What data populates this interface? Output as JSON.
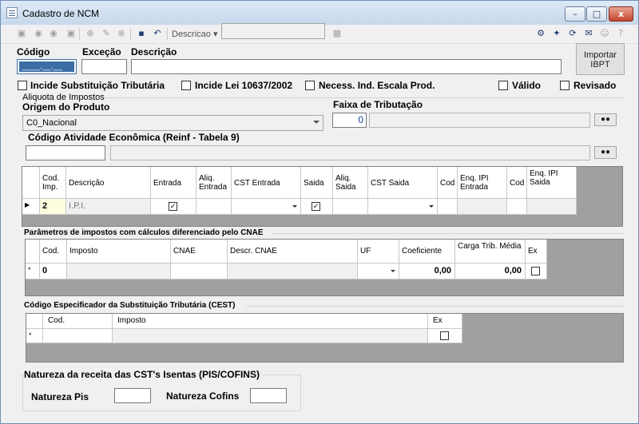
{
  "window": {
    "title": "Cadastro de NCM",
    "minimize_glyph": "–",
    "maximize_glyph": "□",
    "close_glyph": "x"
  },
  "toolbar": {
    "search_field_label": "Descricao",
    "search_value": ""
  },
  "form": {
    "codigo_label": "Código",
    "excecao_label": "Exceção",
    "descricao_label": "Descrição",
    "codigo_value": "____.__.__",
    "excecao_value": "",
    "descricao_value": "",
    "import_button": "Importar IBPT",
    "checkboxes": [
      {
        "label": "Incide Substituição Tributária",
        "checked": false
      },
      {
        "label": "Incide Lei 10637/2002",
        "checked": false
      },
      {
        "label": "Necess. Ind. Escala Prod.",
        "checked": false
      },
      {
        "label": "Válido",
        "checked": false
      },
      {
        "label": "Revisado",
        "checked": false
      }
    ]
  },
  "aliquota": {
    "group_title": "Aliquota de Impostos",
    "origem_label": "Origem do Produto",
    "origem_value": "C0_Nacional",
    "faixa_label": "Faixa de Tributação",
    "faixa_value": "0",
    "atividade_label": "Código Atividade Econômica (Reinf - Tabela 9)",
    "atividade_value": ""
  },
  "impostos_grid": {
    "headers": [
      "Cod. Imp.",
      "Descrição",
      "Entrada",
      "Aliq. Entrada",
      "CST Entrada",
      "Saida",
      "Aliq. Saida",
      "CST Saida",
      "Cod",
      "Enq. IPI Entrada",
      "Cod",
      "Enq. IPI Saida"
    ],
    "row": {
      "cod": "2",
      "descricao": "I.P.I.",
      "entrada": true,
      "saida": true
    }
  },
  "cnae": {
    "group_title": "Parâmetros de impostos com cálculos diferenciado pelo CNAE",
    "headers": [
      "Cod.",
      "Imposto",
      "CNAE",
      "Descr. CNAE",
      "UF",
      "Coeficiente",
      "Carga Trib. Média",
      "Ex"
    ],
    "row": {
      "cod": "0",
      "coeficiente": "0,00",
      "carga": "0,00"
    }
  },
  "cest": {
    "group_title": "Código Especificador da Substituição Tributária (CEST)",
    "headers": [
      "Cod.",
      "Imposto",
      "Ex"
    ]
  },
  "natureza": {
    "group_title": "Natureza da receita das CST's Isentas (PIS/COFINS)",
    "pis_label": "Natureza Pis",
    "cofins_label": "Natureza Cofins",
    "pis_value": "",
    "cofins_value": ""
  },
  "icons": [
    "first-icon",
    "prev-icon",
    "next-icon",
    "last-icon",
    "add-icon",
    "edit-icon",
    "delete-icon",
    "save-icon",
    "undo-icon",
    "grid-icon",
    "binoculars-icon"
  ],
  "colors": {
    "accent": "#3a6ea5",
    "grid_bg": "#a0a0a0",
    "close": "#c2452d"
  }
}
